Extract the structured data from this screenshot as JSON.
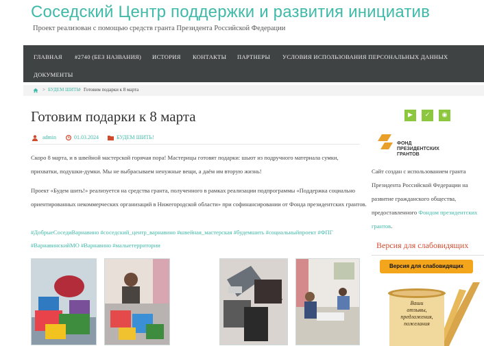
{
  "site": {
    "title": "Соседский Центр поддержки и развития инициатив",
    "tagline": "Проект реализован с помощью средств гранта Президента Российской Федерации"
  },
  "nav": {
    "items": [
      {
        "label": "ГЛАВНАЯ"
      },
      {
        "label": "#2740 (БЕЗ НАЗВАНИЯ)"
      },
      {
        "label": "ИСТОРИЯ"
      },
      {
        "label": "КОНТАКТЫ"
      },
      {
        "label": "ПАРТНЕРЫ"
      },
      {
        "label": "УСЛОВИЯ ИСПОЛЬЗОВАНИЯ ПЕРСОНАЛЬНЫХ ДАННЫХ"
      },
      {
        "label": "ДОКУМЕНТЫ"
      }
    ]
  },
  "breadcrumb": {
    "home_icon": "home-icon",
    "sep1": ">",
    "category": "БУДЕМ ШИТЬ!",
    "sep2": ">",
    "current": "Готовим подарки к 8 марта"
  },
  "post": {
    "title": "Готовим подарки к 8 марта",
    "author": "admin",
    "date": "01.03.2024",
    "category": "БУДЕМ ШИТЬ!",
    "paragraphs": [
      "Скоро 8 марта, и в швейной мастерской горячая пора! Мастерицы готовят подарки: шьют из подручного материала сумки, прихватки, подушки-думки. Мы не выбрасываем ненужные вещи, а даём им вторую жизнь!",
      "Проект «Будем шить!» реализуется на средства гранта, полученного в рамках реализации подпрограммы «Поддержка социально ориентированных некоммерческих организаций в Нижегородской области» при софинансировании от Фонда президентских грантов."
    ],
    "tags": "#ДобрыеСоседиВарнавино #соседский_центр_варнавино #швейная_мастерская #будемшить #социальныйпроект #ФПГ #ВарнавинскийМО #Варнавино #малыетерритории"
  },
  "sidebar": {
    "social_icons": [
      "youtube-icon",
      "vk-icon",
      "rss-icon"
    ],
    "fund_logo_line1": "ФОНД",
    "fund_logo_line2": "ПРЕЗИДЕНТСКИХ",
    "fund_logo_line3": "ГРАНТОВ",
    "info_text": "Сайт создан с использованием гранта Президента Российской Федерации на развитие гражданского общества, предоставленного",
    "info_link": "Фондом президентских грантов",
    "info_end": ".",
    "widget_title": "Версия для слабовидящих",
    "vis_button": "Версия для слабовидящих",
    "scroll_text1": "Ваши",
    "scroll_text2": "отзывы,",
    "scroll_text3": "предложения,",
    "scroll_text4": "пожелания"
  },
  "colors": {
    "accent": "#3fb9a8",
    "nav_bg": "#404344",
    "social_green": "#8dc63f",
    "widget_red": "#d24a2c",
    "button_orange": "#f3a51c"
  }
}
